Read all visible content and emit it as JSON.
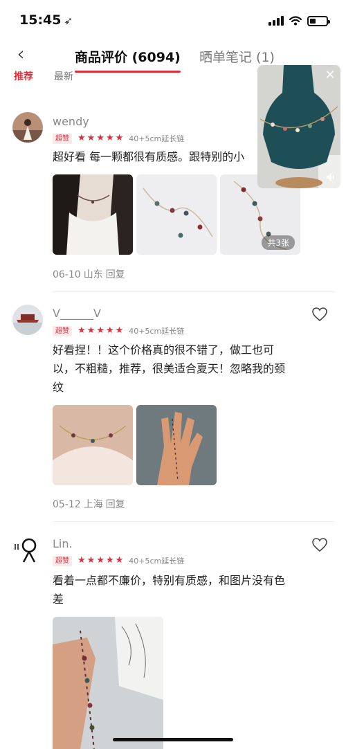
{
  "status_bar": {
    "time": "15:45",
    "location_icon": "location-arrow-icon",
    "battery_level": 0.35
  },
  "nav": {
    "back_icon": "chevron-left-icon",
    "tab_reviews": "商品评价 (6094)",
    "tab_notes": "晒单笔记 (1)"
  },
  "filters": {
    "recommended": "推荐",
    "latest": "最新"
  },
  "reviews": [
    {
      "username": "wendy",
      "badge": "超赞",
      "stars": 5,
      "spec": "40+5cm延长链",
      "content": "超好看 每一颗都很有质感。跟特别的小",
      "photo_count": "共3张",
      "date": "06-10",
      "location": "山东",
      "reply": "回复"
    },
    {
      "username": "V______V",
      "badge": "超赞",
      "stars": 5,
      "spec": "40+5cm延长链",
      "content": "好看捏！！这个价格真的很不错了，做工也可以，不粗糙，推荐，很美适合夏天！忽略我的颈纹",
      "date": "05-12",
      "location": "上海",
      "reply": "回复"
    },
    {
      "username": "Lin.",
      "badge": "超赞",
      "stars": 5,
      "spec": "40+5cm延长链",
      "content": "看着一点都不廉价，特别有质感，和图片没有色差"
    }
  ],
  "colors": {
    "accent": "#e02e3a",
    "muted": "#888888",
    "text": "#222222"
  }
}
